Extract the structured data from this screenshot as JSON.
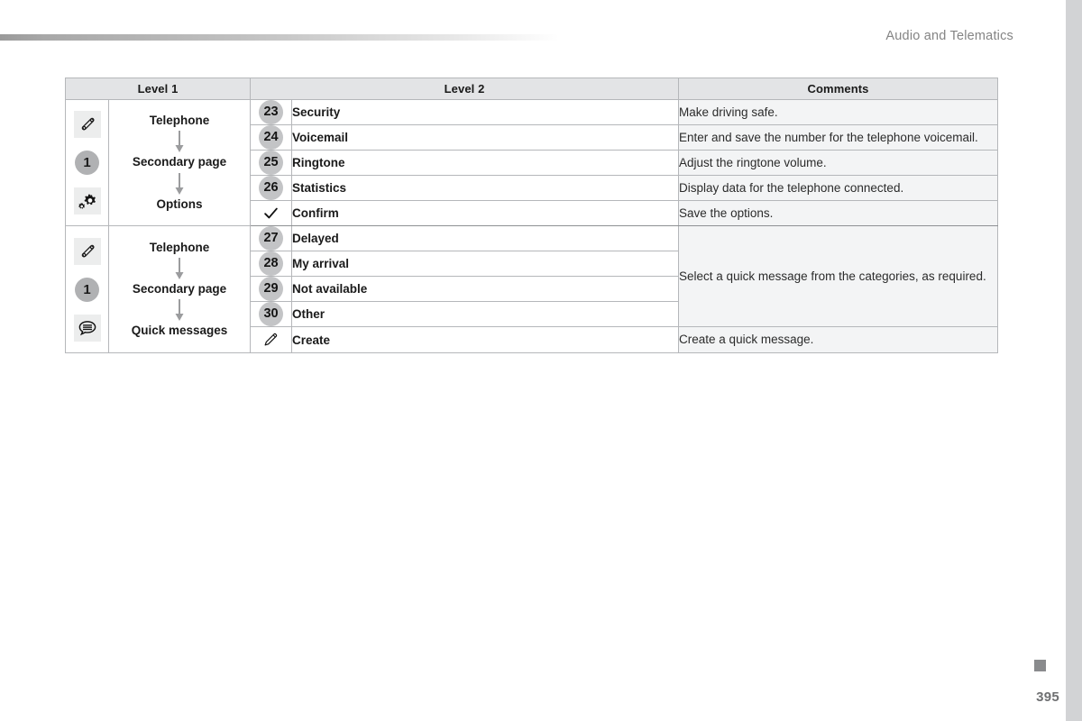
{
  "header": {
    "running_head": "Audio and Telematics"
  },
  "table": {
    "columns": [
      "Level 1",
      "Level 2",
      "Comments"
    ],
    "blocks": [
      {
        "icons": [
          "phone-handset-icon",
          "number-one-badge",
          "gears-options-icon"
        ],
        "badge_number": "1",
        "path": [
          "Telephone",
          "Secondary page",
          "Options"
        ],
        "rows": [
          {
            "badge": "23",
            "glyph": "",
            "label": "Security",
            "comment": "Make driving safe."
          },
          {
            "badge": "24",
            "glyph": "",
            "label": "Voicemail",
            "comment": "Enter and save the number for the telephone voicemail."
          },
          {
            "badge": "25",
            "glyph": "",
            "label": "Ringtone",
            "comment": "Adjust the ringtone volume."
          },
          {
            "badge": "26",
            "glyph": "",
            "label": "Statistics",
            "comment": "Display data for the telephone connected."
          },
          {
            "badge": "",
            "glyph": "check-icon",
            "label": "Confirm",
            "comment": "Save the options."
          }
        ]
      },
      {
        "icons": [
          "phone-handset-icon",
          "number-one-badge",
          "speech-bubble-icon"
        ],
        "badge_number": "1",
        "path": [
          "Telephone",
          "Secondary page",
          "Quick messages"
        ],
        "merged_comment": "Select a quick message from the categories, as required.",
        "rows": [
          {
            "badge": "27",
            "glyph": "",
            "label": "Delayed",
            "comment": ""
          },
          {
            "badge": "28",
            "glyph": "",
            "label": "My arrival",
            "comment": ""
          },
          {
            "badge": "29",
            "glyph": "",
            "label": "Not available",
            "comment": ""
          },
          {
            "badge": "30",
            "glyph": "",
            "label": "Other",
            "comment": ""
          },
          {
            "badge": "",
            "glyph": "pencil-icon",
            "label": "Create",
            "comment": "Create a quick message."
          }
        ]
      }
    ]
  },
  "footer": {
    "page_number": "395"
  },
  "colors": {
    "header_bg": "#e3e4e6",
    "comment_bg": "#f3f4f5",
    "badge_bg": "#c3c4c6",
    "rule_gray": "#9a9a9a",
    "edge_strip": "#d2d3d5"
  }
}
